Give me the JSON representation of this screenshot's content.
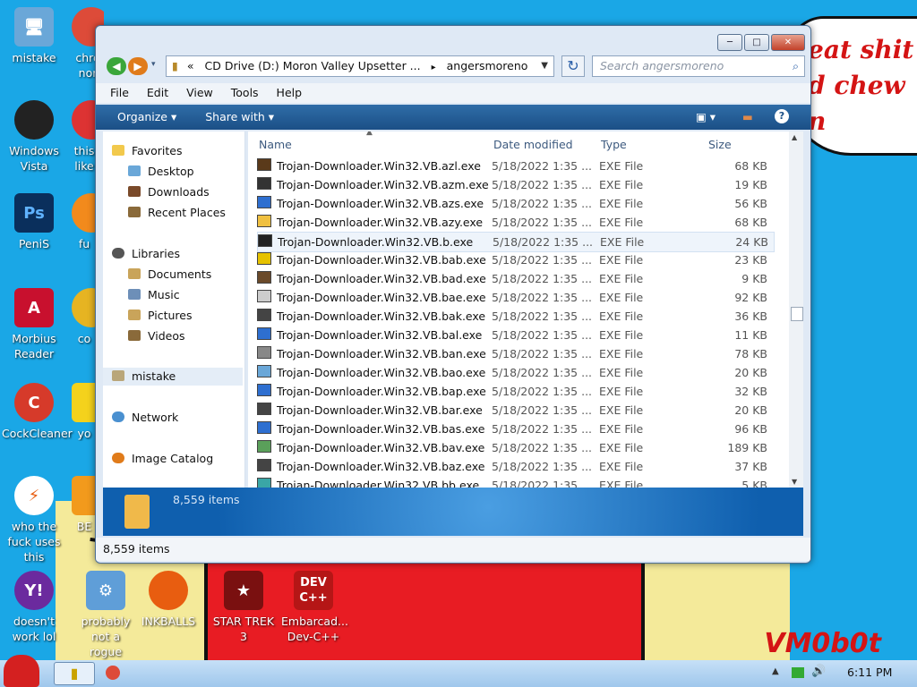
{
  "desktop": {
    "bubble_text": "eat shit\nd chew\nn",
    "watermark": "VM0b0t",
    "icons": [
      {
        "label": "mistake"
      },
      {
        "label": "chro nor"
      },
      {
        "label": "Windows Vista"
      },
      {
        "label": "this like"
      },
      {
        "label": "PeniS"
      },
      {
        "label": "fu"
      },
      {
        "label": "Morbius Reader"
      },
      {
        "label": "co"
      },
      {
        "label": "CockCleaner"
      },
      {
        "label": "yo"
      },
      {
        "label": "who the fuck uses this"
      },
      {
        "label": "BE"
      },
      {
        "label": "doesn't work lol"
      },
      {
        "label": "probably not a rogue"
      },
      {
        "label": "INKBALLS"
      },
      {
        "label": "STAR TREK 3"
      },
      {
        "label": "Embarcad... Dev-C++"
      }
    ]
  },
  "window": {
    "min_label": "─",
    "max_label": "□",
    "close_label": "✕",
    "address": {
      "prefix": "«",
      "path1": "CD Drive (D:) Moron Valley Upsetter ...",
      "sep": "▸",
      "path2": "angersmoreno"
    },
    "search_placeholder": "Search angersmoreno",
    "menu": [
      "File",
      "Edit",
      "View",
      "Tools",
      "Help"
    ],
    "toolbar": {
      "organize": "Organize ▾",
      "share": "Share with ▾"
    },
    "nav": {
      "favorites": "Favorites",
      "desktop": "Desktop",
      "downloads": "Downloads",
      "recent": "Recent Places",
      "libraries": "Libraries",
      "documents": "Documents",
      "music": "Music",
      "pictures": "Pictures",
      "videos": "Videos",
      "mistake": "mistake",
      "network": "Network",
      "image_catalog": "Image Catalog"
    },
    "columns": {
      "name": "Name",
      "date": "Date modified",
      "type": "Type",
      "size": "Size"
    },
    "files": [
      {
        "name": "Trojan-Downloader.Win32.VB.azl.exe",
        "date": "5/18/2022 1:35 ...",
        "type": "EXE File",
        "size": "68 KB"
      },
      {
        "name": "Trojan-Downloader.Win32.VB.azm.exe",
        "date": "5/18/2022 1:35 ...",
        "type": "EXE File",
        "size": "19 KB"
      },
      {
        "name": "Trojan-Downloader.Win32.VB.azs.exe",
        "date": "5/18/2022 1:35 ...",
        "type": "EXE File",
        "size": "56 KB"
      },
      {
        "name": "Trojan-Downloader.Win32.VB.azy.exe",
        "date": "5/18/2022 1:35 ...",
        "type": "EXE File",
        "size": "68 KB"
      },
      {
        "name": "Trojan-Downloader.Win32.VB.b.exe",
        "date": "5/18/2022 1:35 ...",
        "type": "EXE File",
        "size": "24 KB"
      },
      {
        "name": "Trojan-Downloader.Win32.VB.bab.exe",
        "date": "5/18/2022 1:35 ...",
        "type": "EXE File",
        "size": "23 KB"
      },
      {
        "name": "Trojan-Downloader.Win32.VB.bad.exe",
        "date": "5/18/2022 1:35 ...",
        "type": "EXE File",
        "size": "9 KB"
      },
      {
        "name": "Trojan-Downloader.Win32.VB.bae.exe",
        "date": "5/18/2022 1:35 ...",
        "type": "EXE File",
        "size": "92 KB"
      },
      {
        "name": "Trojan-Downloader.Win32.VB.bak.exe",
        "date": "5/18/2022 1:35 ...",
        "type": "EXE File",
        "size": "36 KB"
      },
      {
        "name": "Trojan-Downloader.Win32.VB.bal.exe",
        "date": "5/18/2022 1:35 ...",
        "type": "EXE File",
        "size": "11 KB"
      },
      {
        "name": "Trojan-Downloader.Win32.VB.ban.exe",
        "date": "5/18/2022 1:35 ...",
        "type": "EXE File",
        "size": "78 KB"
      },
      {
        "name": "Trojan-Downloader.Win32.VB.bao.exe",
        "date": "5/18/2022 1:35 ...",
        "type": "EXE File",
        "size": "20 KB"
      },
      {
        "name": "Trojan-Downloader.Win32.VB.bap.exe",
        "date": "5/18/2022 1:35 ...",
        "type": "EXE File",
        "size": "32 KB"
      },
      {
        "name": "Trojan-Downloader.Win32.VB.bar.exe",
        "date": "5/18/2022 1:35 ...",
        "type": "EXE File",
        "size": "20 KB"
      },
      {
        "name": "Trojan-Downloader.Win32.VB.bas.exe",
        "date": "5/18/2022 1:35 ...",
        "type": "EXE File",
        "size": "96 KB"
      },
      {
        "name": "Trojan-Downloader.Win32.VB.bav.exe",
        "date": "5/18/2022 1:35 ...",
        "type": "EXE File",
        "size": "189 KB"
      },
      {
        "name": "Trojan-Downloader.Win32.VB.baz.exe",
        "date": "5/18/2022 1:35 ...",
        "type": "EXE File",
        "size": "37 KB"
      },
      {
        "name": "Trojan-Downloader.Win32.VB.bb.exe",
        "date": "5/18/2022 1:35 ...",
        "type": "EXE File",
        "size": "5 KB"
      }
    ],
    "details_count": "8,559 items",
    "status_count": "8,559 items"
  },
  "taskbar": {
    "clock": "6:11 PM"
  },
  "colors": {
    "desktop_bg": "#1aa7e6",
    "toolbar_bg": "#1b4f86",
    "wall_red": "#e81c23",
    "wall_yellow": "#f4ea9a"
  }
}
